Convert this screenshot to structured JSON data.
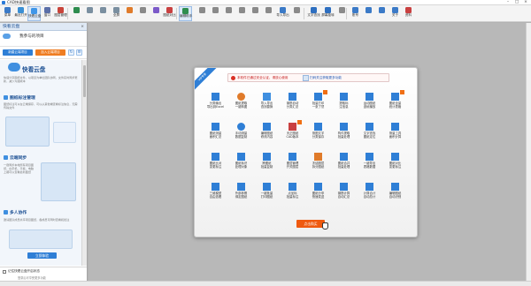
{
  "window": {
    "title": "CAD快速看图",
    "min": "–",
    "max": "□",
    "close": "×"
  },
  "toolbar": {
    "items": [
      {
        "label": "菜单",
        "color": "#3b7ac7",
        "icon": "menu-icon"
      },
      {
        "label": "最近打开",
        "color": "#3a8fd4",
        "icon": "recent-icon"
      },
      {
        "label": "快看云盘",
        "color": "#3f96e8",
        "icon": "cloud-icon"
      },
      {
        "label": "窗口",
        "color": "#5b6fa8",
        "icon": "window-icon"
      },
      {
        "label": "图层管理",
        "color": "#c9443a",
        "icon": "layer-icon"
      },
      {
        "label": "",
        "color": "#2e8d4e",
        "icon": "drawing-icon"
      },
      {
        "label": "",
        "color": "#7a8fa0",
        "icon": "undo-icon"
      },
      {
        "label": "",
        "color": "#7a8fa0",
        "icon": "redo-icon"
      },
      {
        "label": "全屏",
        "color": "#7a8fa0",
        "icon": "fullscreen-icon"
      },
      {
        "label": "",
        "color": "#e07b2a",
        "icon": "zoom-icon"
      },
      {
        "label": "",
        "color": "#8a8a8a",
        "icon": "search-icon"
      },
      {
        "label": "",
        "color": "#7c5ac9",
        "icon": "text-icon"
      },
      {
        "label": "图纸对比",
        "color": "#c94040",
        "icon": "compare-icon"
      },
      {
        "label": "编辑助手",
        "color": "#2e8d4e",
        "icon": "edit-icon"
      },
      {
        "label": "",
        "color": "#8a8a8a",
        "icon": "measure-icon"
      },
      {
        "label": "",
        "color": "#8a8a8a",
        "icon": "area-icon"
      },
      {
        "label": "",
        "color": "#8a8a8a",
        "icon": "angle-icon"
      },
      {
        "label": "",
        "color": "#8a8a8a",
        "icon": "arc-icon"
      },
      {
        "label": "",
        "color": "#8a8a8a",
        "icon": "count-icon"
      },
      {
        "label": "",
        "color": "#8a8a8a",
        "icon": "mark-icon"
      },
      {
        "label": "导入导出",
        "color": "#3b7ac7",
        "icon": "import-icon"
      },
      {
        "label": "",
        "color": "#8a8a8a",
        "icon": "print-icon"
      },
      {
        "label": "文字查找",
        "color": "#2e6fc0",
        "icon": "find-text-icon"
      },
      {
        "label": "屏幕旋转",
        "color": "#2e6fc0",
        "icon": "rotate-icon"
      },
      {
        "label": "",
        "color": "#8a8a8a",
        "icon": "settings-icon"
      },
      {
        "label": "账号",
        "color": "#3b7ac7",
        "icon": "account-icon"
      },
      {
        "label": "",
        "color": "#3b7ac7",
        "icon": "vip-icon"
      },
      {
        "label": "",
        "color": "#3b7ac7",
        "icon": "help-icon"
      },
      {
        "label": "关于",
        "color": "#3b7ac7",
        "icon": "about-icon"
      },
      {
        "label": "资料",
        "color": "#c94040",
        "icon": "docs-icon"
      }
    ]
  },
  "sidebar": {
    "header": "快看云盘",
    "close": "×",
    "project_label": "我参与的项目",
    "btn_new": "新建云端项目",
    "btn_join": "加入云端项目",
    "refresh": "↻",
    "settings": "⚙",
    "promo_title": "快看云盘",
    "promo_text": "快速分享图纸文件，以项目为单位团队协同，文件实时同步更新，减少沟通成本",
    "sec1": "图纸标注管理",
    "sec1_text": "图纸标注可以在云端保存，可以从其他端查看标注信息，无需传输文件",
    "sec2": "云端同步",
    "sec2_text": "一键同步本地所有项目图纸，在手机、平板、电脑上都可以查看最新图纸",
    "sec3": "多人协作",
    "sec3_text": "邀请团队成员共享项目图纸，各成员可同时查看和批注",
    "cta": "立即体验",
    "foot_check": "记住快看云盘开启状态",
    "foot_note": "登录后可享受更多功能"
  },
  "dialog": {
    "ribbon": "VIP专享",
    "notice_main": "本软件已通过安全认证，请放心使用",
    "notice_link": "扫码关注获取更多功能",
    "buy": "点击购买",
    "features": [
      {
        "label": "分类输出\n导出到Excel",
        "color": "#2f7fd6",
        "shape": "square",
        "hot": false
      },
      {
        "label": "图纸提取\n一键转图",
        "color": "#e07b2a",
        "shape": "round",
        "hot": false
      },
      {
        "label": "导入导出\n查找替换",
        "color": "#3f8fe0",
        "shape": "square",
        "hot": false
      },
      {
        "label": "钢筋自动\n分类汇总",
        "color": "#2f7fd6",
        "shape": "square",
        "hot": false
      },
      {
        "label": "批量打印\n一张了然",
        "color": "#2f7fd6",
        "shape": "square",
        "hot": true
      },
      {
        "label": "提取标\n注信息",
        "color": "#2f7fd6",
        "shape": "square",
        "hot": false
      },
      {
        "label": "运动图纸\n逐帧播放",
        "color": "#2f7fd6",
        "shape": "square",
        "hot": false
      },
      {
        "label": "图纸全量\n统计表格",
        "color": "#2f7fd6",
        "shape": "square",
        "hot": true
      },
      {
        "label": "图纸测量\n面积汇总",
        "color": "#2f7fd6",
        "shape": "square",
        "hot": false
      },
      {
        "label": "手动测量\n数据复制",
        "color": "#2f7fd6",
        "shape": "round",
        "hot": false
      },
      {
        "label": "编辑图纸\n修改内容",
        "color": "#2f7fd6",
        "shape": "square",
        "hot": false
      },
      {
        "label": "天正图纸\nCAD版本",
        "color": "#c94040",
        "shape": "square",
        "hot": true
      },
      {
        "label": "测图文字\n分类保存",
        "color": "#2f7fd6",
        "shape": "square",
        "hot": false
      },
      {
        "label": "构件提取\n批量处理",
        "color": "#2f7fd6",
        "shape": "square",
        "hot": false
      },
      {
        "label": "文字查找\n图纸定位",
        "color": "#2f7fd6",
        "shape": "square",
        "hot": false
      },
      {
        "label": "测量工具\n面积计算",
        "color": "#2f7fd6",
        "shape": "square",
        "hot": false
      },
      {
        "label": "图纸比对\n变更标注",
        "color": "#2f7fd6",
        "shape": "square",
        "hot": false
      },
      {
        "label": "图纸标识\n处理对象",
        "color": "#2f7fd6",
        "shape": "square",
        "hot": false
      },
      {
        "label": "跨图纸\n批量复制",
        "color": "#2f7fd6",
        "shape": "square",
        "hot": false
      },
      {
        "label": "图层管理\n开关图层",
        "color": "#2f7fd6",
        "shape": "square",
        "hot": false
      },
      {
        "label": "冻结图层\n拆分图纸",
        "color": "#e07b2a",
        "shape": "square",
        "hot": false
      },
      {
        "label": "图纸合并\n批量处理",
        "color": "#2f7fd6",
        "shape": "square",
        "hot": false
      },
      {
        "label": "一键导出\n表格数据",
        "color": "#2f7fd6",
        "shape": "square",
        "hot": false
      },
      {
        "label": "图纸对比\n变更标注",
        "color": "#2f7fd6",
        "shape": "square",
        "hot": false
      },
      {
        "label": "三维模型\n自由查看",
        "color": "#2f7fd6",
        "shape": "square",
        "hot": false
      },
      {
        "label": "外部参照\n绑定图纸",
        "color": "#2f7fd6",
        "shape": "square",
        "hot": false
      },
      {
        "label": "一键批量\n打印图纸",
        "color": "#2f7fd6",
        "shape": "square",
        "hot": false
      },
      {
        "label": "点坐标\n批量标注",
        "color": "#2f7fd6",
        "shape": "square",
        "hot": false
      },
      {
        "label": "图纸分享\n快速发送",
        "color": "#2f7fd6",
        "shape": "square",
        "hot": false
      },
      {
        "label": "钢筋计算\n自动汇总",
        "color": "#2f7fd6",
        "shape": "square",
        "hot": false
      },
      {
        "label": "计算合计\n自动总计",
        "color": "#2f7fd6",
        "shape": "square",
        "hot": false
      },
      {
        "label": "编辑图纸\n自动识别",
        "color": "#2f7fd6",
        "shape": "square",
        "hot": false
      }
    ]
  }
}
